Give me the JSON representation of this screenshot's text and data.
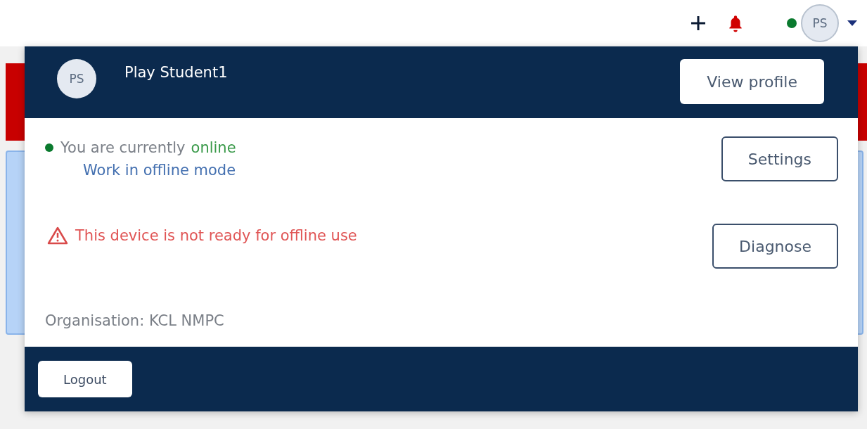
{
  "top_bar": {
    "avatar_initials": "PS",
    "presence_online": true
  },
  "profile_menu": {
    "avatar_initials": "PS",
    "user_name": "Play Student1",
    "view_profile_button": "View profile",
    "status": {
      "prefix": "You are currently",
      "state": "online",
      "online": true,
      "offline_link": "Work in offline mode",
      "settings_button": "Settings"
    },
    "warning": {
      "text": "This device is not ready for offline use",
      "diagnose_button": "Diagnose"
    },
    "organisation": "Organisation: KCL NMPC",
    "logout_button": "Logout"
  }
}
